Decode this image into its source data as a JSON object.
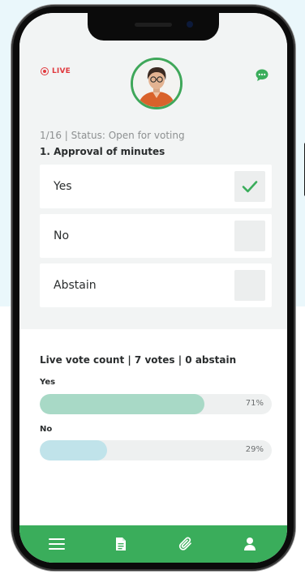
{
  "status": {
    "live_label": "LIVE"
  },
  "poll": {
    "meta": "1/16 | Status: Open for voting",
    "question": "1. Approval of minutes",
    "options": [
      {
        "label": "Yes",
        "checked": true
      },
      {
        "label": "No",
        "checked": false
      },
      {
        "label": "Abstain",
        "checked": false
      }
    ]
  },
  "live_count": {
    "title": "Live vote count | 7 votes | 0 abstain",
    "results": [
      {
        "label": "Yes",
        "percent_label": "71%",
        "fraction": 0.71,
        "color": "#a8d9c6"
      },
      {
        "label": "No",
        "percent_label": "29%",
        "fraction": 0.29,
        "color": "#c0e3ea"
      }
    ]
  },
  "nav": {
    "items": [
      {
        "icon": "menu-icon"
      },
      {
        "icon": "document-icon"
      },
      {
        "icon": "paperclip-icon"
      },
      {
        "icon": "user-icon"
      }
    ]
  },
  "colors": {
    "accent": "#3aad5b",
    "live": "#e0393e"
  }
}
